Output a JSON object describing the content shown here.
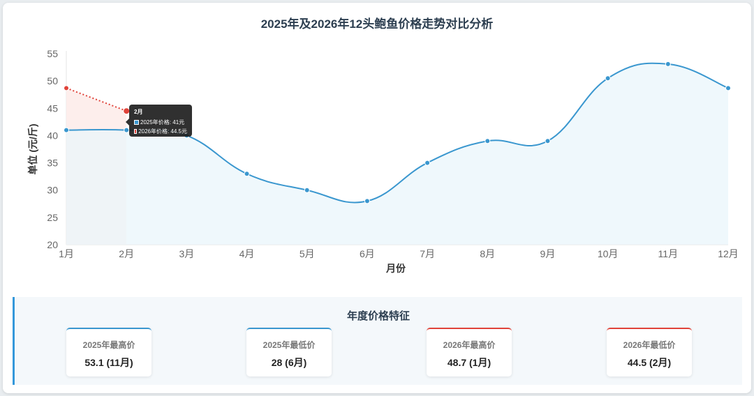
{
  "chart_data": {
    "type": "line",
    "title": "2025年及2026年12头鲍鱼价格走势对比分析",
    "xlabel": "月份",
    "ylabel": "单位 (元/斤)",
    "categories": [
      "1月",
      "2月",
      "3月",
      "4月",
      "5月",
      "6月",
      "7月",
      "8月",
      "9月",
      "10月",
      "11月",
      "12月"
    ],
    "ylim": [
      20,
      55
    ],
    "yticks": [
      20,
      25,
      30,
      35,
      40,
      45,
      50,
      55
    ],
    "series": [
      {
        "name": "2025年价格",
        "color": "#3a97cf",
        "fill": "#eaf5fb",
        "values": [
          41,
          41,
          40,
          33,
          30,
          28,
          35,
          39,
          39,
          50.5,
          53.1,
          48.7
        ]
      },
      {
        "name": "2026年价格",
        "color": "#e0433a",
        "fill": "#fdecea",
        "values": [
          48.7,
          44.5
        ]
      }
    ],
    "grid": false,
    "tooltip": {
      "title": "2月",
      "lines": [
        "2025年价格: 41元",
        "2026年价格: 44.5元"
      ]
    }
  },
  "summary": {
    "title": "年度价格特征",
    "cards": [
      {
        "label": "2025年最高价",
        "value": "53.1 (11月)",
        "accent": "#3a97cf"
      },
      {
        "label": "2025年最低价",
        "value": "28 (6月)",
        "accent": "#3a97cf"
      },
      {
        "label": "2026年最高价",
        "value": "48.7 (1月)",
        "accent": "#e0433a"
      },
      {
        "label": "2026年最低价",
        "value": "44.5 (2月)",
        "accent": "#e0433a"
      }
    ]
  }
}
